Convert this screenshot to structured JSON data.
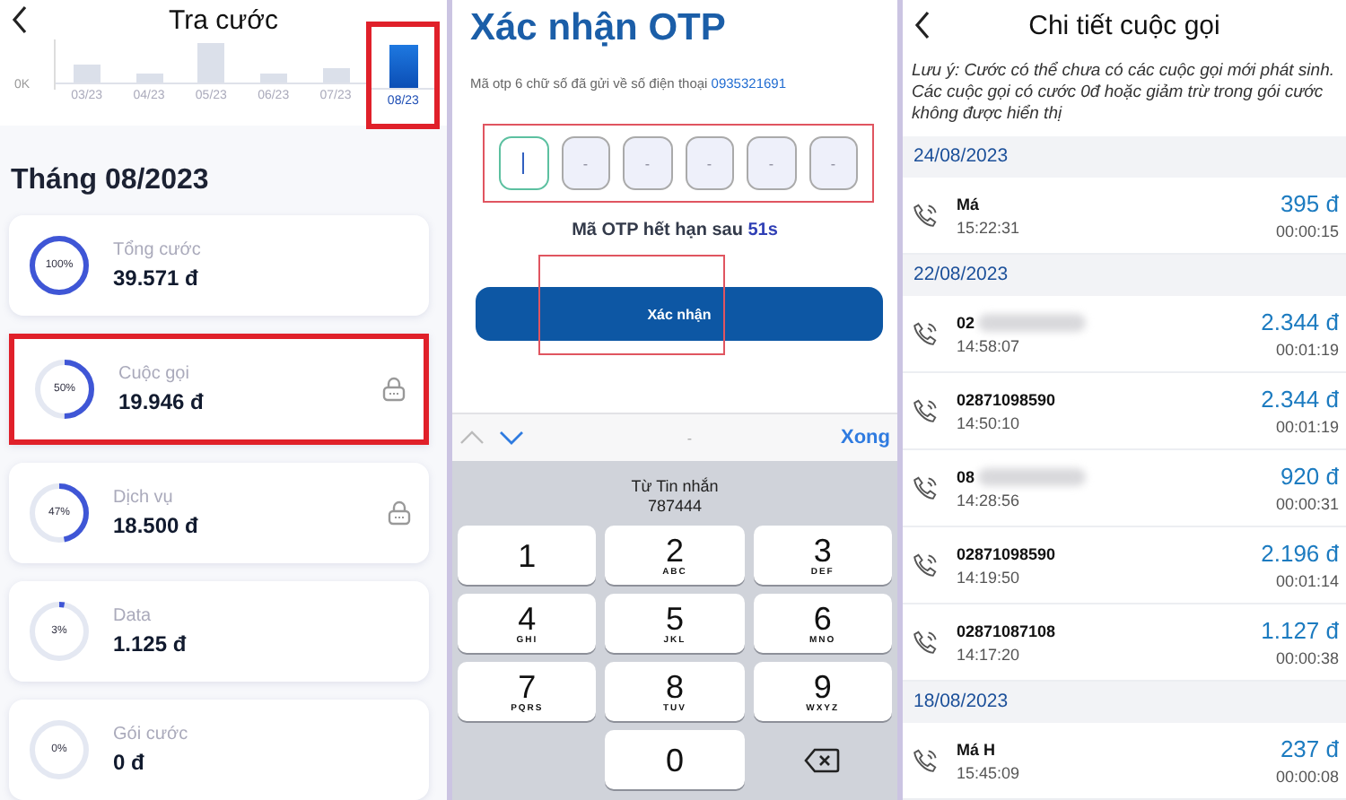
{
  "billing": {
    "title": "Tra cước",
    "axis_label": "0K",
    "months": [
      {
        "label": "03/23",
        "selected": false,
        "highlighted": false
      },
      {
        "label": "04/23",
        "selected": false,
        "highlighted": false
      },
      {
        "label": "05/23",
        "selected": false,
        "highlighted": false
      },
      {
        "label": "06/23",
        "selected": false,
        "highlighted": false
      },
      {
        "label": "07/23",
        "selected": false,
        "highlighted": false
      },
      {
        "label": "08/23",
        "selected": true,
        "highlighted": true
      }
    ],
    "heading": "Tháng 08/2023",
    "cards": [
      {
        "percent": "100%",
        "level": 1,
        "label": "Tổng cước",
        "amount": "39.571 đ",
        "locked": false,
        "highlighted": false
      },
      {
        "percent": "50%",
        "level": 0.5,
        "label": "Cuộc gọi",
        "amount": "19.946 đ",
        "locked": true,
        "highlighted": true
      },
      {
        "percent": "47%",
        "level": 0.47,
        "label": "Dịch vụ",
        "amount": "18.500 đ",
        "locked": true,
        "highlighted": false
      },
      {
        "percent": "3%",
        "level": 0.03,
        "label": "Data",
        "amount": "1.125 đ",
        "locked": false,
        "highlighted": false
      },
      {
        "percent": "0%",
        "level": 0,
        "label": "Gói cước",
        "amount": "0 đ",
        "locked": false,
        "highlighted": false
      }
    ]
  },
  "otp": {
    "title": "Xác nhận OTP",
    "hint": "Mã otp 6 chữ số đã gửi về số điện thoại",
    "phone": "0935321691",
    "boxes": [
      {
        "focused": true
      },
      {
        "value": "-",
        "focused": false
      },
      {
        "value": "-",
        "focused": false
      },
      {
        "value": "-",
        "focused": false
      },
      {
        "value": "-",
        "focused": false
      },
      {
        "value": "-",
        "focused": false
      }
    ],
    "boxes_highlighted": true,
    "expiry": "Mã OTP hết hạn sau",
    "seconds": "51s",
    "button": "Xác nhận",
    "button_highlighted": true,
    "toolbar": {
      "center": "-",
      "done": "Xong"
    },
    "suggestion": {
      "source": "Từ Tin nhắn",
      "code": "787444"
    },
    "keys": [
      {
        "kind": "digit",
        "digit": "1"
      },
      {
        "kind": "digit",
        "digit": "2",
        "letters": "ABC"
      },
      {
        "kind": "digit",
        "digit": "3",
        "letters": "DEF"
      },
      {
        "kind": "digit",
        "digit": "4",
        "letters": "GHI"
      },
      {
        "kind": "digit",
        "digit": "5",
        "letters": "JKL"
      },
      {
        "kind": "digit",
        "digit": "6",
        "letters": "MNO"
      },
      {
        "kind": "digit",
        "digit": "7",
        "letters": "PQRS"
      },
      {
        "kind": "digit",
        "digit": "8",
        "letters": "TUV"
      },
      {
        "kind": "digit",
        "digit": "9",
        "letters": "WXYZ"
      },
      {
        "kind": "blank"
      },
      {
        "kind": "digit",
        "digit": "0"
      },
      {
        "kind": "delete"
      }
    ]
  },
  "calls": {
    "title": "Chi tiết cuộc gọi",
    "note": "Lưu ý: Cước có thể chưa có các cuộc gọi mới phát sinh. Các cuộc gọi có cước 0đ hoặc giảm trừ trong gói cước không được hiển thị",
    "groups": [
      {
        "date": "24/08/2023",
        "items": [
          {
            "name": "Má",
            "blurred": false,
            "time": "15:22:31",
            "amount": "395 đ",
            "duration": "00:00:15"
          }
        ]
      },
      {
        "date": "22/08/2023",
        "items": [
          {
            "name": "02",
            "blurred": true,
            "time": "14:58:07",
            "amount": "2.344 đ",
            "duration": "00:01:19"
          },
          {
            "name": "02871098590",
            "blurred": false,
            "time": "14:50:10",
            "amount": "2.344 đ",
            "duration": "00:01:19"
          },
          {
            "name": "08",
            "blurred": true,
            "time": "14:28:56",
            "amount": "920 đ",
            "duration": "00:00:31"
          },
          {
            "name": "02871098590",
            "blurred": false,
            "time": "14:19:50",
            "amount": "2.196 đ",
            "duration": "00:01:14"
          },
          {
            "name": "02871087108",
            "blurred": false,
            "time": "14:17:20",
            "amount": "1.127 đ",
            "duration": "00:00:38"
          }
        ]
      },
      {
        "date": "18/08/2023",
        "items": [
          {
            "name": "Má H",
            "blurred": false,
            "time": "15:45:09",
            "amount": "237 đ",
            "duration": "00:00:08"
          }
        ]
      }
    ]
  }
}
